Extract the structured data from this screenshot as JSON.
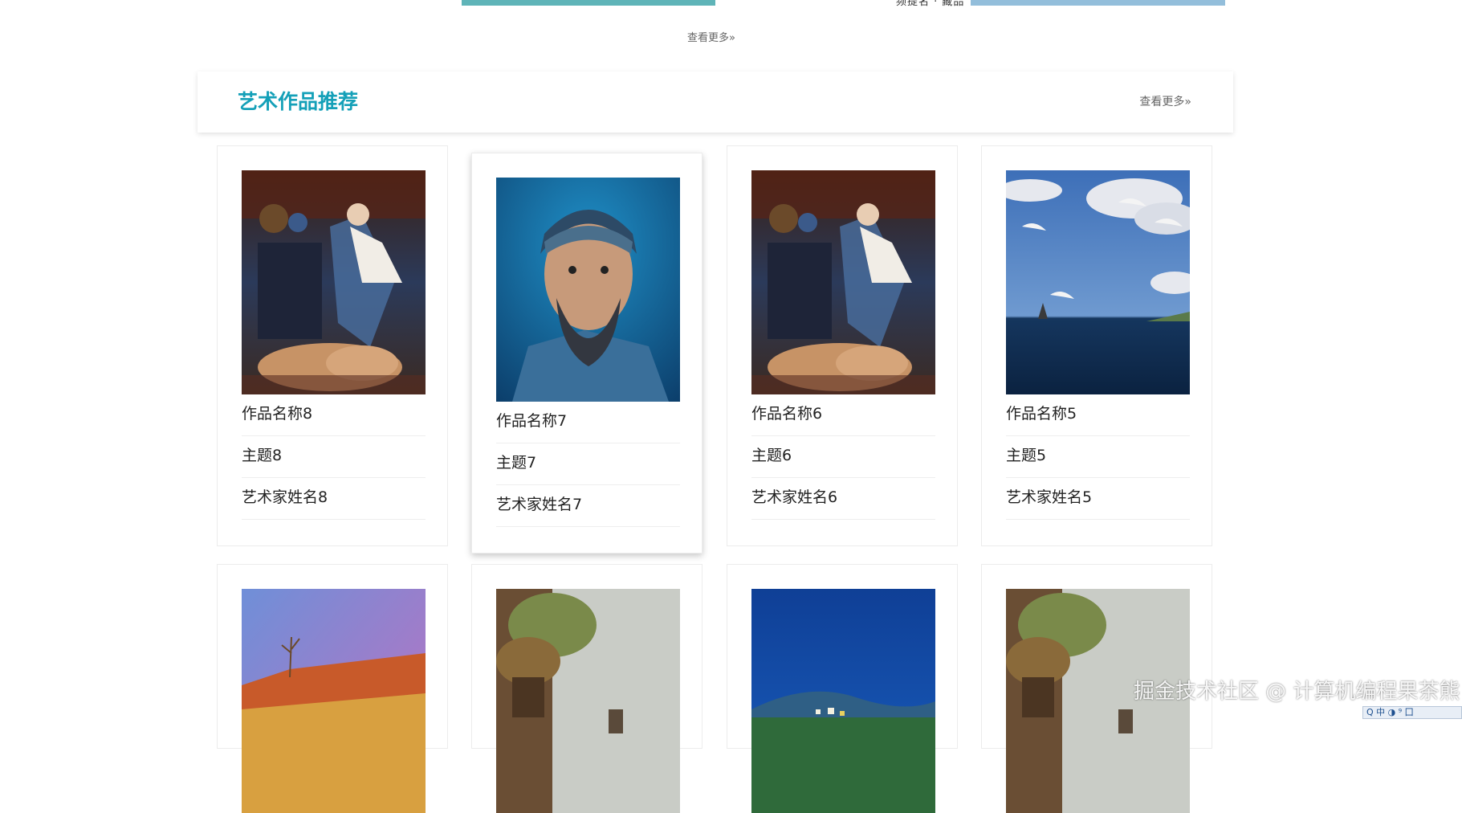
{
  "top": {
    "cut_text": "频提名 · 藏品",
    "more_label": "查看更多»"
  },
  "section": {
    "title": "艺术作品推荐",
    "more_label": "查看更多»"
  },
  "artworks": [
    {
      "name": "作品名称8",
      "theme": "主题8",
      "artist": "艺术家姓名8",
      "image": "still-life-child-dog"
    },
    {
      "name": "作品名称7",
      "theme": "主题7",
      "artist": "艺术家姓名7",
      "image": "portrait-bearded-man-bandana"
    },
    {
      "name": "作品名称6",
      "theme": "主题6",
      "artist": "艺术家姓名6",
      "image": "still-life-child-dog"
    },
    {
      "name": "作品名称5",
      "theme": "主题5",
      "artist": "艺术家姓名5",
      "image": "seascape-swans-clouds"
    }
  ],
  "artworks_row2_images": [
    "desert-red-cliffs",
    "old-town-street",
    "blue-night-village",
    "old-town-street"
  ],
  "watermark": "掘金技术社区 @ 计算机编程果茶熊",
  "tray_text": "Q 中 ◑ ⁹ 囗",
  "colors": {
    "accent": "#14a0b8"
  }
}
